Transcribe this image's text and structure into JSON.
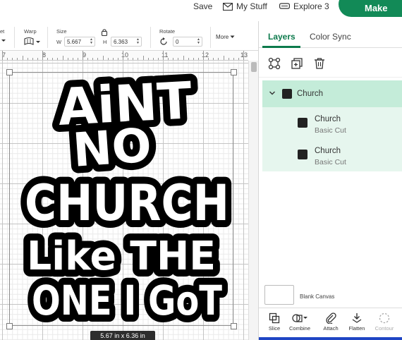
{
  "header": {
    "save_label": "Save",
    "mystuff_label": "My Stuff",
    "explore_label": "Explore 3",
    "make_label": "Make"
  },
  "toolbar": {
    "offset_partial": "et",
    "warp_label": "Warp",
    "size_label": "Size",
    "w_label": "W",
    "w_value": "5.667",
    "h_label": "H",
    "h_value": "6.363",
    "rotate_label": "Rotate",
    "rotate_value": "0",
    "more_label": "More"
  },
  "ruler": {
    "numbers": [
      "7",
      "8",
      "9",
      "10",
      "11",
      "12",
      "13"
    ]
  },
  "canvas": {
    "dimensions_label": "5.67  in x 6.36  in",
    "artwork_lines": [
      "AiNT",
      "NO",
      "CHURCH",
      "Like THE",
      "ONE I GoT"
    ]
  },
  "panel": {
    "tabs": [
      {
        "label": "Layers"
      },
      {
        "label": "Color Sync"
      }
    ],
    "group": {
      "name": "Church"
    },
    "layers": [
      {
        "name": "Church",
        "type": "Basic Cut"
      },
      {
        "name": "Church",
        "type": "Basic Cut"
      }
    ],
    "blank_canvas_label": "Blank Canvas",
    "bottom_tools": [
      {
        "label": "Slice",
        "enabled": true
      },
      {
        "label": "Combine",
        "enabled": true
      },
      {
        "label": "Attach",
        "enabled": true
      },
      {
        "label": "Flatten",
        "enabled": true
      },
      {
        "label": "Contour",
        "enabled": false
      }
    ]
  },
  "colors": {
    "brand_green": "#128a57",
    "selected_layer_bg": "#c4ecd9",
    "child_layer_bg": "#e6f6ee",
    "bottom_strip": "#1f45c4"
  }
}
